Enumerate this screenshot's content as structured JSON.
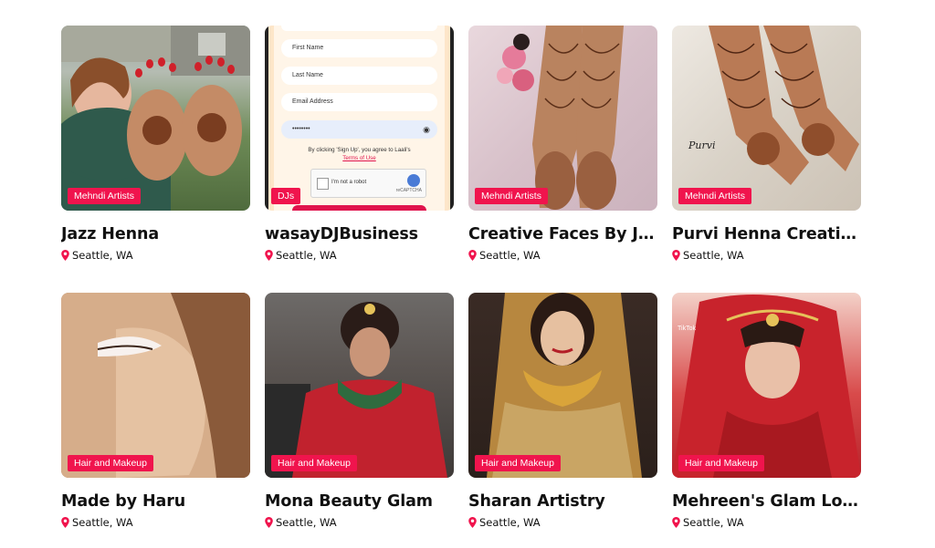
{
  "cards": [
    {
      "name": "Jazz Henna",
      "category": "Mehndi Artists",
      "location": "Seattle, WA"
    },
    {
      "name": "wasayDJBusiness",
      "category": "DJs",
      "location": "Seattle, WA"
    },
    {
      "name": "Creative Faces By Jain",
      "category": "Mehndi Artists",
      "location": "Seattle, WA"
    },
    {
      "name": "Purvi Henna Creations",
      "category": "Mehndi Artists",
      "location": "Seattle, WA"
    },
    {
      "name": "Made by Haru",
      "category": "Hair and Makeup",
      "location": "Seattle, WA"
    },
    {
      "name": "Mona Beauty Glam",
      "category": "Hair and Makeup",
      "location": "Seattle, WA"
    },
    {
      "name": "Sharan Artistry",
      "category": "Hair and Makeup",
      "location": "Seattle, WA"
    },
    {
      "name": "Mehreen's Glam Lou...",
      "category": "Hair and Makeup",
      "location": "Seattle, WA"
    }
  ],
  "signup_mock": {
    "first_name": "First Name",
    "last_name": "Last Name",
    "email": "Email Address",
    "password": "••••••••",
    "agree": "By clicking 'Sign Up', you agree to Laali's",
    "terms": "Terms of Use",
    "captcha": "I'm not a robot",
    "captcha_brand": "reCAPTCHA",
    "captcha_sub": "Privacy - Terms"
  },
  "purvi_logo": "Purvi",
  "tiktok_mark": "TikTok",
  "colors": {
    "accent": "#f0144d",
    "pin": "#f0144d"
  },
  "icons": {
    "location": "map-pin-icon"
  }
}
